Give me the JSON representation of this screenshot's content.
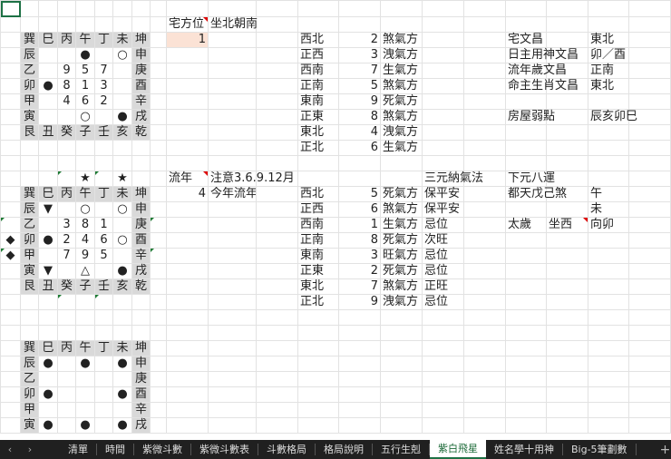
{
  "colors": {
    "header_gray": "#d9d9d9",
    "highlight": "#fbe2d5",
    "accent": "#1e7145"
  },
  "house": {
    "label": "宅方位",
    "value": "1",
    "facing": "坐北朝南"
  },
  "chart1": [
    [
      "巽",
      "巳",
      "丙",
      "午",
      "丁",
      "未",
      "坤"
    ],
    [
      "辰",
      "",
      "",
      "●",
      "",
      "○",
      "申"
    ],
    [
      "乙",
      "",
      "9",
      "5",
      "7",
      "",
      "庚"
    ],
    [
      "卯",
      "●",
      "8",
      "1",
      "3",
      "",
      "酉"
    ],
    [
      "甲",
      "",
      "4",
      "6",
      "2",
      "",
      "辛"
    ],
    [
      "寅",
      "",
      "",
      "○",
      "",
      "●",
      "戌"
    ],
    [
      "艮",
      "丑",
      "癸",
      "子",
      "壬",
      "亥",
      "乾"
    ]
  ],
  "directions1": [
    [
      "西北",
      "2",
      "煞氣方"
    ],
    [
      "正西",
      "3",
      "洩氣方"
    ],
    [
      "西南",
      "7",
      "生氣方"
    ],
    [
      "正南",
      "5",
      "煞氣方"
    ],
    [
      "東南",
      "9",
      "死氣方"
    ],
    [
      "正東",
      "8",
      "煞氣方"
    ],
    [
      "東北",
      "4",
      "洩氣方"
    ],
    [
      "正北",
      "6",
      "生氣方"
    ]
  ],
  "wenchang": [
    [
      "宅文昌",
      "東北"
    ],
    [
      "日主用神文昌",
      "卯／酉"
    ],
    [
      "流年歲文昌",
      "正南"
    ],
    [
      "命主生肖文昌",
      "東北"
    ],
    [
      "",
      ""
    ],
    [
      "房屋弱點",
      "辰亥卯巳"
    ]
  ],
  "annual": {
    "label": "流年",
    "note": "注意3.6.9.12月",
    "value": "4",
    "title": "今年流年飛星盤",
    "sanyuan": "三元納氣法",
    "period": "下元八運"
  },
  "stars": [
    "★",
    "★"
  ],
  "diamonds": [
    "◆",
    "◆"
  ],
  "chart2": [
    [
      "巽",
      "巳",
      "丙",
      "午",
      "丁",
      "未",
      "坤"
    ],
    [
      "辰",
      "▼",
      "",
      "○",
      "",
      "○",
      "申"
    ],
    [
      "乙",
      "",
      "3",
      "8",
      "1",
      "",
      "庚"
    ],
    [
      "卯",
      "●",
      "2",
      "4",
      "6",
      "○",
      "酉"
    ],
    [
      "甲",
      "",
      "7",
      "9",
      "5",
      "",
      "辛"
    ],
    [
      "寅",
      "▼",
      "",
      "△",
      "",
      "●",
      "戌"
    ],
    [
      "艮",
      "丑",
      "癸",
      "子",
      "壬",
      "亥",
      "乾"
    ]
  ],
  "directions2": [
    [
      "西北",
      "5",
      "死氣方",
      "保平安"
    ],
    [
      "正西",
      "6",
      "煞氣方",
      "保平安"
    ],
    [
      "西南",
      "1",
      "生氣方",
      "忌位"
    ],
    [
      "正南",
      "8",
      "死氣方",
      "次旺"
    ],
    [
      "東南",
      "3",
      "旺氣方",
      "忌位"
    ],
    [
      "正東",
      "2",
      "死氣方",
      "忌位"
    ],
    [
      "東北",
      "7",
      "煞氣方",
      "正旺"
    ],
    [
      "正北",
      "9",
      "洩氣方",
      "忌位"
    ]
  ],
  "sha": {
    "label": "都天戊己煞",
    "values": [
      "午",
      "未"
    ]
  },
  "taisui": {
    "label": "太歲",
    "sit": "坐西",
    "face": "向卯"
  },
  "chart3": [
    [
      "巽",
      "巳",
      "丙",
      "午",
      "丁",
      "未",
      "坤"
    ],
    [
      "辰",
      "●",
      "",
      "●",
      "",
      "●",
      "申"
    ],
    [
      "乙",
      "",
      "",
      "",
      "",
      "",
      "庚"
    ],
    [
      "卯",
      "●",
      "",
      "",
      "",
      "●",
      "酉"
    ],
    [
      "甲",
      "",
      "",
      "",
      "",
      "",
      "辛"
    ],
    [
      "寅",
      "●",
      "",
      "●",
      "",
      "●",
      "戌"
    ]
  ],
  "tabs": [
    "清單",
    "時間",
    "紫微斗數",
    "紫微斗數表",
    "斗數格局",
    "格局說明",
    "五行生剋",
    "紫白飛星",
    "姓名學十用神",
    "Big-5筆劃數"
  ],
  "active_tab": "紫白飛星",
  "nav": {
    "prev": "‹",
    "next": "›",
    "add": "+"
  }
}
